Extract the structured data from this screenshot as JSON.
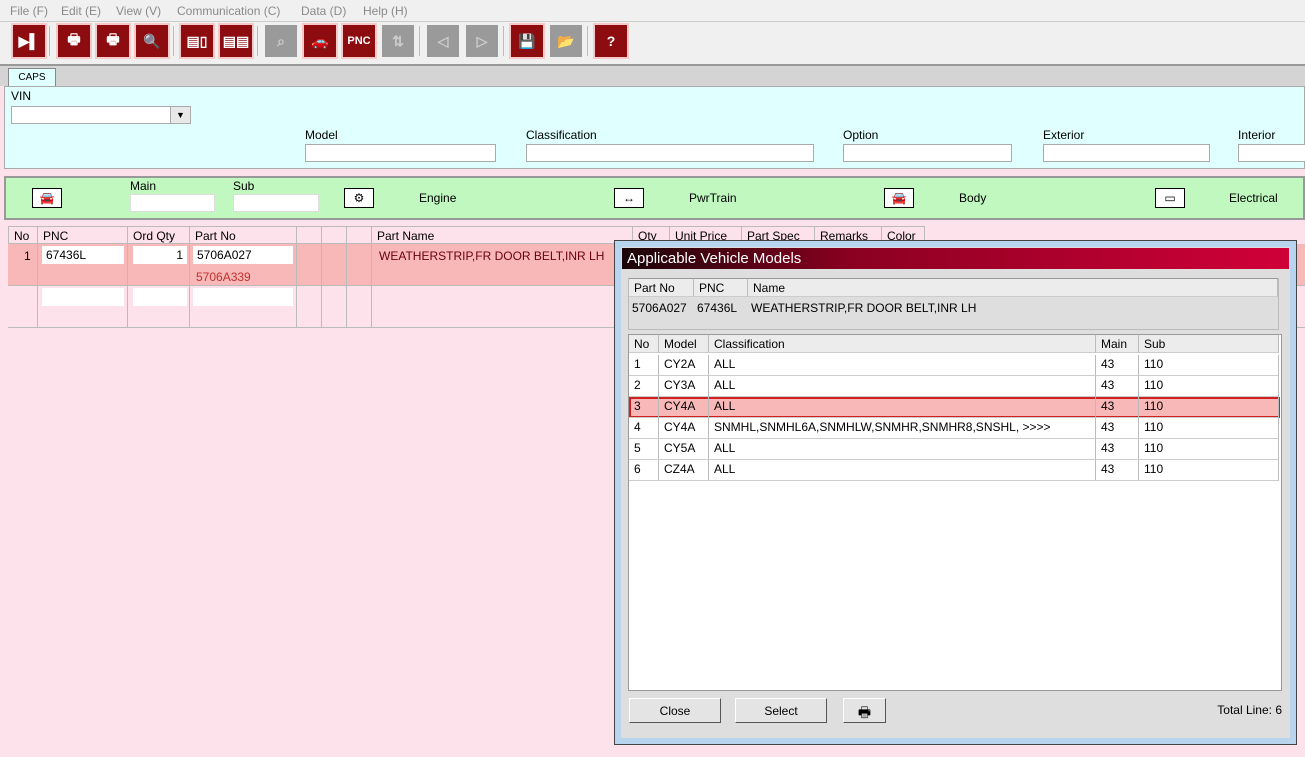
{
  "menu": [
    "File (F)",
    "Edit (E)",
    "View (V)",
    "Communication (C)",
    "Data (D)",
    "Help (H)"
  ],
  "toolbar": [
    {
      "icon": "exit-icon",
      "glyph": "▶▌",
      "disabled": false
    },
    {
      "icon": "print-screen-icon",
      "glyph": "🖶",
      "disabled": false
    },
    {
      "icon": "printer-icon",
      "glyph": "🖶",
      "disabled": false
    },
    {
      "icon": "print-preview-icon",
      "glyph": "🔍",
      "disabled": false
    },
    {
      "icon": "list-view-icon",
      "glyph": "▤▯",
      "disabled": false
    },
    {
      "icon": "list-view-2-icon",
      "glyph": "▤▤",
      "disabled": false
    },
    {
      "icon": "binoculars-icon",
      "glyph": "⌕",
      "disabled": true
    },
    {
      "icon": "car-icon",
      "glyph": "🚗",
      "disabled": false
    },
    {
      "icon": "pnc-icon",
      "glyph": "PNC",
      "disabled": false
    },
    {
      "icon": "transfer-icon",
      "glyph": "⇅",
      "disabled": true
    },
    {
      "icon": "previous-icon",
      "glyph": "◁",
      "disabled": true
    },
    {
      "icon": "next-icon",
      "glyph": "▷",
      "disabled": true
    },
    {
      "icon": "save-icon",
      "glyph": "💾",
      "disabled": false
    },
    {
      "icon": "open-folder-icon",
      "glyph": "📂",
      "disabled": true
    },
    {
      "icon": "help-icon",
      "glyph": "?",
      "disabled": false
    }
  ],
  "tab": "CAPS",
  "vin": {
    "label": "VIN",
    "value": ""
  },
  "filters": {
    "model": "Model",
    "classification": "Classification",
    "option": "Option",
    "exterior": "Exterior",
    "interior": "Interior"
  },
  "groups": {
    "main": "Main",
    "sub": "Sub",
    "engine": "Engine",
    "pwrtrain": "PwrTrain",
    "body": "Body",
    "electrical": "Electrical"
  },
  "parts_table": {
    "headers": [
      "No",
      "PNC",
      "Ord Qty",
      "Part No",
      "",
      "",
      "",
      "Part Name",
      "Qty",
      "Unit Price",
      "Part Spec",
      "Remarks",
      "Color"
    ],
    "rows": [
      {
        "no": "1",
        "pnc": "67436L",
        "qty": "1",
        "part_no": "5706A027",
        "alt_part_no": "5706A339",
        "name": "WEATHERSTRIP,FR DOOR BELT,INR LH"
      }
    ]
  },
  "dialog": {
    "title": "Applicable Vehicle Models",
    "part_headers": [
      "Part No",
      "PNC",
      "Name"
    ],
    "part": {
      "part_no": "5706A027",
      "pnc": "67436L",
      "name": "WEATHERSTRIP,FR DOOR BELT,INR LH"
    },
    "model_headers": [
      "No",
      "Model",
      "Classification",
      "Main",
      "Sub"
    ],
    "models": [
      [
        "1",
        "CY2A",
        "ALL",
        "43",
        "110"
      ],
      [
        "2",
        "CY3A",
        "ALL",
        "43",
        "110"
      ],
      [
        "3",
        "CY4A",
        "ALL",
        "43",
        "110"
      ],
      [
        "4",
        "CY4A",
        "SNMHL,SNMHL6A,SNMHLW,SNMHR,SNMHR8,SNSHL,  >>>>",
        "43",
        "110"
      ],
      [
        "5",
        "CY5A",
        "ALL",
        "43",
        "110"
      ],
      [
        "6",
        "CZ4A",
        "ALL",
        "43",
        "110"
      ]
    ],
    "selected_row": 3,
    "close": "Close",
    "select": "Select",
    "total": "Total Line: 6"
  },
  "colors": {
    "accent": "#8c0c10",
    "selected_row": "#f8b8b8",
    "cyan_panel": "#e0ffff",
    "green_panel": "#c0f8c0"
  }
}
